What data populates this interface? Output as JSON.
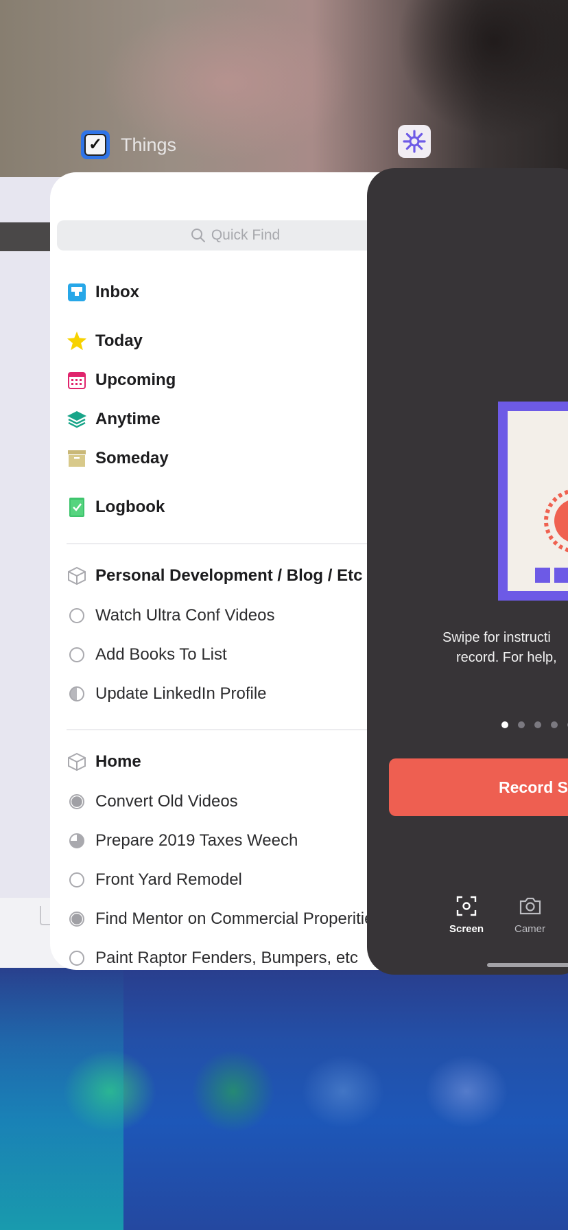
{
  "apps": {
    "things": {
      "name": "Things",
      "search_placeholder": "Quick Find",
      "lists": [
        {
          "label": "Inbox",
          "icon": "inbox-icon"
        },
        {
          "label": "Today",
          "icon": "star-icon"
        },
        {
          "label": "Upcoming",
          "icon": "calendar-icon"
        },
        {
          "label": "Anytime",
          "icon": "layers-icon"
        },
        {
          "label": "Someday",
          "icon": "archive-box-icon"
        },
        {
          "label": "Logbook",
          "icon": "logbook-icon"
        }
      ],
      "areas": [
        {
          "title": "Personal Development / Blog / Etc",
          "tasks": [
            "Watch Ultra Conf Videos",
            "Add Books To List",
            "Update LinkedIn Profile"
          ]
        },
        {
          "title": "Home",
          "tasks": [
            "Convert Old Videos",
            "Prepare 2019 Taxes Weech",
            "Front Yard Remodel",
            "Find Mentor on Commercial Properities",
            "Paint Raptor Fenders, Bumpers, etc"
          ]
        }
      ]
    },
    "recorder": {
      "instruction_line1": "Swipe for instructi",
      "instruction_line2": "record. For help,",
      "record_button": "Record Sc",
      "tabs": [
        "Screen",
        "Camer"
      ]
    }
  },
  "colors": {
    "record_accent": "#ee5f51",
    "illustration_purple": "#6d5ae6",
    "things_blue": "#2f74e8"
  }
}
